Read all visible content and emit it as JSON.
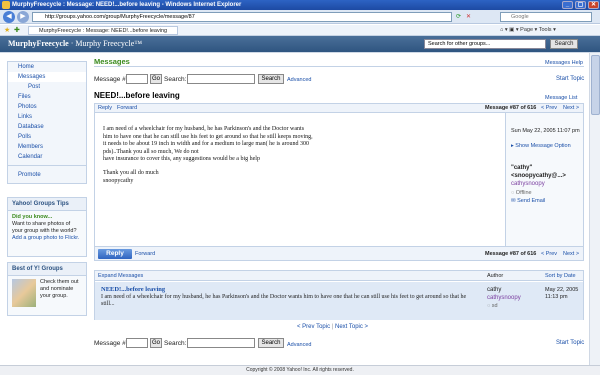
{
  "window": {
    "title": "MurphyFreecycle : Message: NEED!...before leaving - Windows Internet Explorer",
    "controls": [
      "_",
      "▢",
      "✕"
    ]
  },
  "browser": {
    "url": "http://groups.yahoo.com/group/MurphyFreecycle/message/87",
    "search_placeholder": "Google",
    "tab_label": "MurphyFreecycle : Message: NEED!...before leaving",
    "tools": "⌂ ▾  ▣ ▾  Page ▾  Tools ▾"
  },
  "header": {
    "brand": "MurphyFreecycle",
    "brand_sub": " · Murphy Freecycle™",
    "search_value": "Search for other groups...",
    "search_button": "Search"
  },
  "nav": {
    "items": [
      "Home",
      "Messages",
      "Post",
      "Files",
      "Photos",
      "Links",
      "Database",
      "Polls",
      "Members",
      "Calendar"
    ],
    "promote": "Promote"
  },
  "tips": {
    "title": "Yahoo! Groups Tips",
    "did_you_know": "Did you know...",
    "text": "Want to share photos of your group with the world? ",
    "link": "Add a group photo to Flickr."
  },
  "best": {
    "title": "Best of Y! Groups",
    "text": "Check them out and nominate your group."
  },
  "main": {
    "section": "Messages",
    "help": "Messages Help",
    "start_topic": "Start Topic",
    "message_label": "Message #",
    "go": "Go",
    "search_label": "Search:",
    "search_button": "Search",
    "advanced": "Advanced",
    "title": "NEED!...before leaving",
    "message_list": "Message List"
  },
  "message": {
    "reply": "Reply",
    "forward": "Forward",
    "counter": "Message #87 of 616",
    "prev": "< Prev",
    "next": "Next >",
    "body": [
      "I am need of a wheelchair for my husband, he has Parkinson's and the Doctor wants him to have one that he can still use his feet to get around so that he still keeps moving, it needs to be about 19 inch in width and for a medium to large man( he is around 300 pds)..Thank you all so much, We do not",
      "have insurance to cover this, any suggestions would be a big help",
      "",
      "Thank you all do much",
      "snoopycathy"
    ],
    "date": "Sun May 22, 2005 11:07 pm",
    "show_option": "Show Message Option",
    "from_name": "\"cathy\"",
    "from_email": "<snoopycathy@...>",
    "from_id": "cathysnoopy",
    "offline": "Offline",
    "send_email": "Send Email",
    "reply_button": "Reply"
  },
  "expanded": {
    "label": "Expand Messages",
    "author_col": "Author",
    "sort": "Sort by Date",
    "subject": "NEED!...before leaving",
    "snippet": "I am need of a wheelchair for my husband, he has Parkinson's and the Doctor wants him to have one that he can still use his feet to get around so that he still...",
    "author": "cathy",
    "author_id": "cathysnoopy",
    "author_status": "sd",
    "date": "May 22, 2005",
    "time": "11:13 pm"
  },
  "pager": {
    "prev": "< Prev Topic",
    "next": "Next Topic >"
  },
  "footer": "Copyright © 2008 Yahoo! Inc. All rights reserved."
}
